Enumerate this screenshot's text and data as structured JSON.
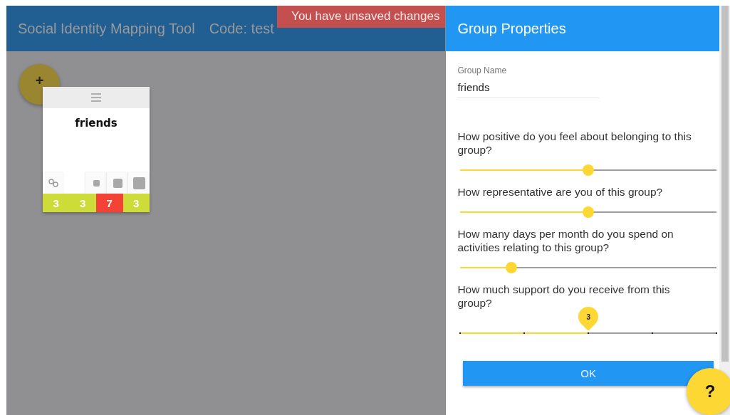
{
  "header": {
    "title": "Social Identity Mapping Tool",
    "code": "Code: test"
  },
  "notice": "You have unsaved changes",
  "add_button": {
    "label": "+"
  },
  "group_card": {
    "name": "friends",
    "counts": [
      {
        "value": "3",
        "color": "#cddc39"
      },
      {
        "value": "3",
        "color": "#cddc39"
      },
      {
        "value": "7",
        "color": "#f44336"
      },
      {
        "value": "3",
        "color": "#cddc39"
      }
    ]
  },
  "panel": {
    "title": "Group Properties",
    "name_field": {
      "label": "Group Name",
      "value": "friends"
    },
    "questions": [
      {
        "kind": "slider",
        "text": "How positive do you feel about belonging to this group?",
        "level": 0.5
      },
      {
        "kind": "slider",
        "text": "How representative are you of this group?",
        "level": 0.5
      },
      {
        "kind": "slider",
        "text": "How many days per month do you spend on activities relating to this group?",
        "level": 0.2
      },
      {
        "kind": "stepped",
        "text": "How much support do you receive from this group?",
        "level": 0.5,
        "value_label": "3"
      }
    ],
    "ok_button": "OK"
  },
  "help_button": "?"
}
